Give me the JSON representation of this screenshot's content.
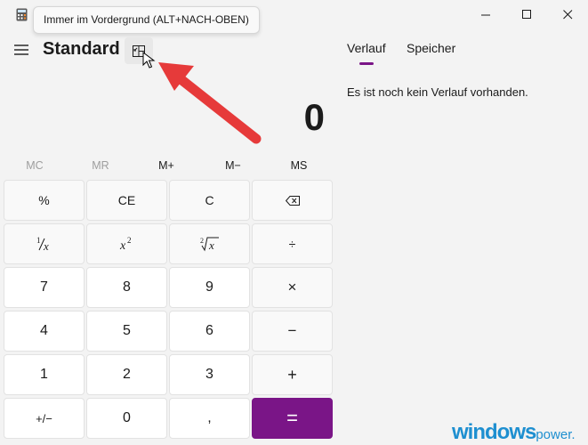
{
  "window": {
    "tooltip": "Immer im Vordergrund (ALT+NACH-OBEN)"
  },
  "header": {
    "mode_title": "Standard"
  },
  "display": {
    "value": "0"
  },
  "memory": {
    "buttons": [
      "MC",
      "MR",
      "M+",
      "M−",
      "MS"
    ]
  },
  "keypad": {
    "row1": [
      "%",
      "CE",
      "C"
    ],
    "row3": [
      "7",
      "8",
      "9"
    ],
    "row4": [
      "4",
      "5",
      "6"
    ],
    "row5": [
      "1",
      "2",
      "3"
    ],
    "row6": [
      "0",
      ","
    ],
    "ops": {
      "divide": "÷",
      "multiply": "×",
      "minus": "−",
      "plus": "+",
      "equals": "="
    },
    "negate": "+/−"
  },
  "history": {
    "tabs": [
      "Verlauf",
      "Speicher"
    ],
    "empty_text": "Es ist noch kein Verlauf vorhanden."
  },
  "colors": {
    "accent": "#7a1587",
    "background": "#f3f3f3"
  },
  "watermark": {
    "main": "windows",
    "sub": "power."
  }
}
